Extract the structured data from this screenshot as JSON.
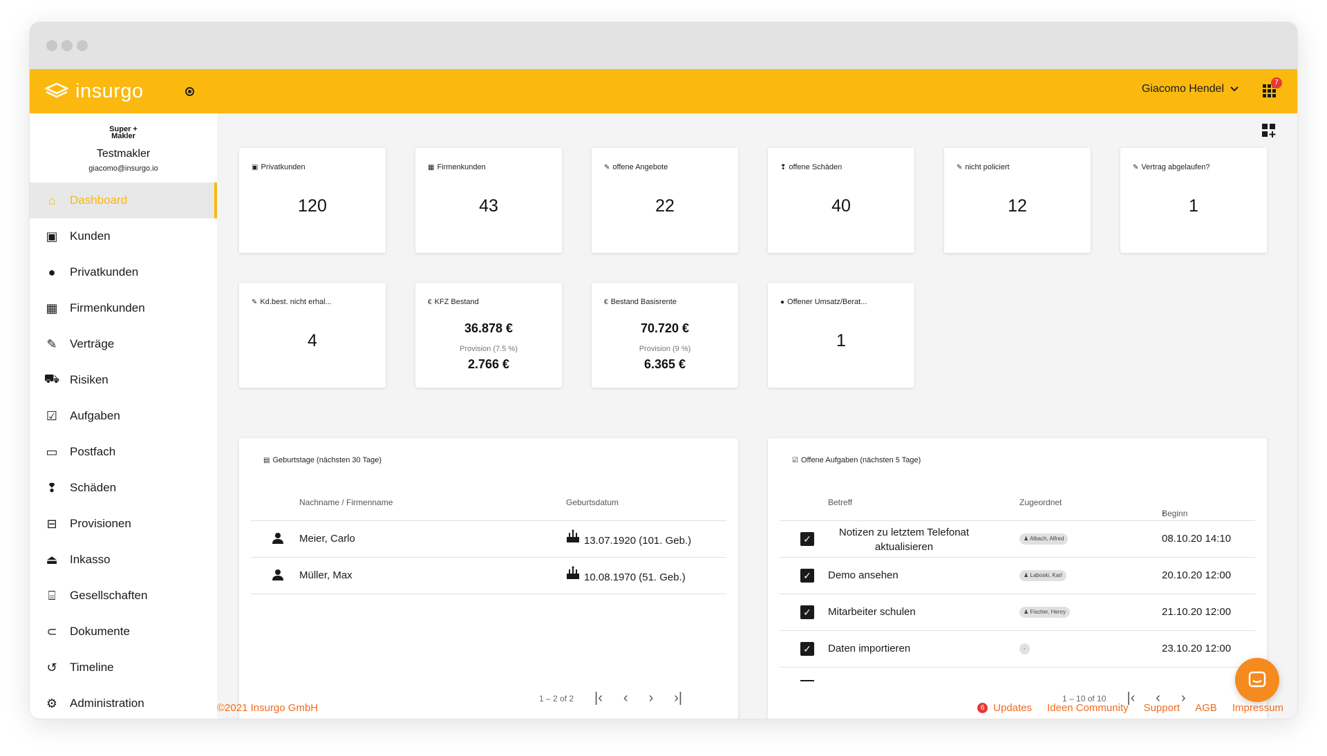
{
  "app": {
    "logo_text": "insurgo",
    "user_name": "Giacomo Hendel",
    "apps_badge": "7"
  },
  "sidebar": {
    "brand_line1": "Super +",
    "brand_line2": "Makler",
    "company": "Testmakler",
    "email": "giacomo@insurgo.io",
    "items": [
      {
        "label": "Dashboard",
        "icon": "home-icon"
      },
      {
        "label": "Kunden",
        "icon": "contact-card-icon"
      },
      {
        "label": "Privatkunden",
        "icon": "person-icon"
      },
      {
        "label": "Firmenkunden",
        "icon": "building-icon"
      },
      {
        "label": "Verträge",
        "icon": "pencil-icon"
      },
      {
        "label": "Risiken",
        "icon": "risk-icon"
      },
      {
        "label": "Aufgaben",
        "icon": "checkbox-icon"
      },
      {
        "label": "Postfach",
        "icon": "inbox-icon"
      },
      {
        "label": "Schäden",
        "icon": "report-icon"
      },
      {
        "label": "Provisionen",
        "icon": "wallet-icon"
      },
      {
        "label": "Inkasso",
        "icon": "eject-icon"
      },
      {
        "label": "Gesellschaften",
        "icon": "bank-icon"
      },
      {
        "label": "Dokumente",
        "icon": "paperclip-icon"
      },
      {
        "label": "Timeline",
        "icon": "history-icon"
      },
      {
        "label": "Administration",
        "icon": "gear-icon"
      }
    ]
  },
  "stats": [
    {
      "label": "Privatkunden",
      "value": "120"
    },
    {
      "label": "Firmenkunden",
      "value": "43"
    },
    {
      "label": "offene Angebote",
      "value": "22"
    },
    {
      "label": "offene Schäden",
      "value": "40"
    },
    {
      "label": "nicht policiert",
      "value": "12"
    },
    {
      "label": "Vertrag abgelaufen?",
      "value": "1"
    },
    {
      "label": "Kd.best. nicht erhal...",
      "value": "4"
    },
    {
      "label": "Offener Umsatz/Berat...",
      "value": "1"
    }
  ],
  "money": [
    {
      "label": "KFZ Bestand",
      "value": "36.878 €",
      "provision_label": "Provision (7.5 %)",
      "provision": "2.766 €"
    },
    {
      "label": "Bestand Basisrente",
      "value": "70.720 €",
      "provision_label": "Provision (9 %)",
      "provision": "6.365 €"
    }
  ],
  "birthdays": {
    "title": "Geburtstage (nächsten 30 Tage)",
    "col_name": "Nachname / Firmenname",
    "col_date": "Geburtsdatum",
    "rows": [
      {
        "name": "Meier, Carlo",
        "date": "13.07.1920 (101. Geb.)"
      },
      {
        "name": "Müller, Max",
        "date": "10.08.1970 (51. Geb.)"
      }
    ],
    "pager": "1 – 2 of 2"
  },
  "tasks": {
    "title": "Offene Aufgaben (nächsten 5 Tage)",
    "col_subject": "Betreff",
    "col_assigned": "Zugeordnet",
    "col_start": "Beginn",
    "rows": [
      {
        "subject": "Notizen zu letztem Telefonat aktualisieren",
        "assigned": "Albach, Alfred",
        "start": "08.10.20 14:10"
      },
      {
        "subject": "Demo ansehen",
        "assigned": "Laboski, Karl",
        "start": "20.10.20 12:00"
      },
      {
        "subject": "Mitarbeiter schulen",
        "assigned": "Fischer, Henry",
        "start": "21.10.20 12:00"
      },
      {
        "subject": "Daten importieren",
        "assigned": "-",
        "start": "23.10.20 12:00"
      }
    ],
    "pager": "1 – 10 of 10"
  },
  "footer": {
    "copyright": "©2021 Insurgo GmbH",
    "updates_badge": "6",
    "updates": "Updates",
    "community": "Ideen Community",
    "support": "Support",
    "agb": "AGB",
    "impressum": "Impressum"
  },
  "colors": {
    "brand": "#fbb90f",
    "accent": "#f26b1d"
  }
}
